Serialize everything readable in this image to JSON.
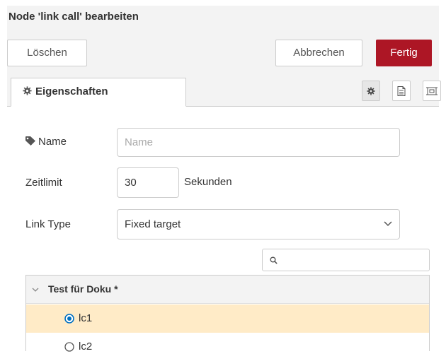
{
  "title": "Node 'link call' bearbeiten",
  "toolbar": {
    "delete_label": "Löschen",
    "cancel_label": "Abbrechen",
    "done_label": "Fertig"
  },
  "tabs": {
    "properties_label": "Eigenschaften"
  },
  "form": {
    "name_label": "Name",
    "name_placeholder": "Name",
    "name_value": "",
    "timeout_label": "Zeitlimit",
    "timeout_value": "30",
    "timeout_unit": "Sekunden",
    "linktype_label": "Link Type",
    "linktype_value": "Fixed target",
    "search_value": ""
  },
  "tree": {
    "group_label": "Test für Doku *",
    "items": [
      {
        "label": "lc1",
        "selected": true
      },
      {
        "label": "lc2",
        "selected": false
      }
    ]
  },
  "colors": {
    "primary": "#ad1625",
    "selected_row": "#ffebc7",
    "radio_selected": "#0070c1",
    "panel_bg": "#f3f3f3"
  },
  "icons": [
    "gear-icon",
    "tag-icon",
    "description-icon",
    "appearance-icon",
    "search-icon",
    "chevron-down-icon",
    "radio-icon"
  ]
}
